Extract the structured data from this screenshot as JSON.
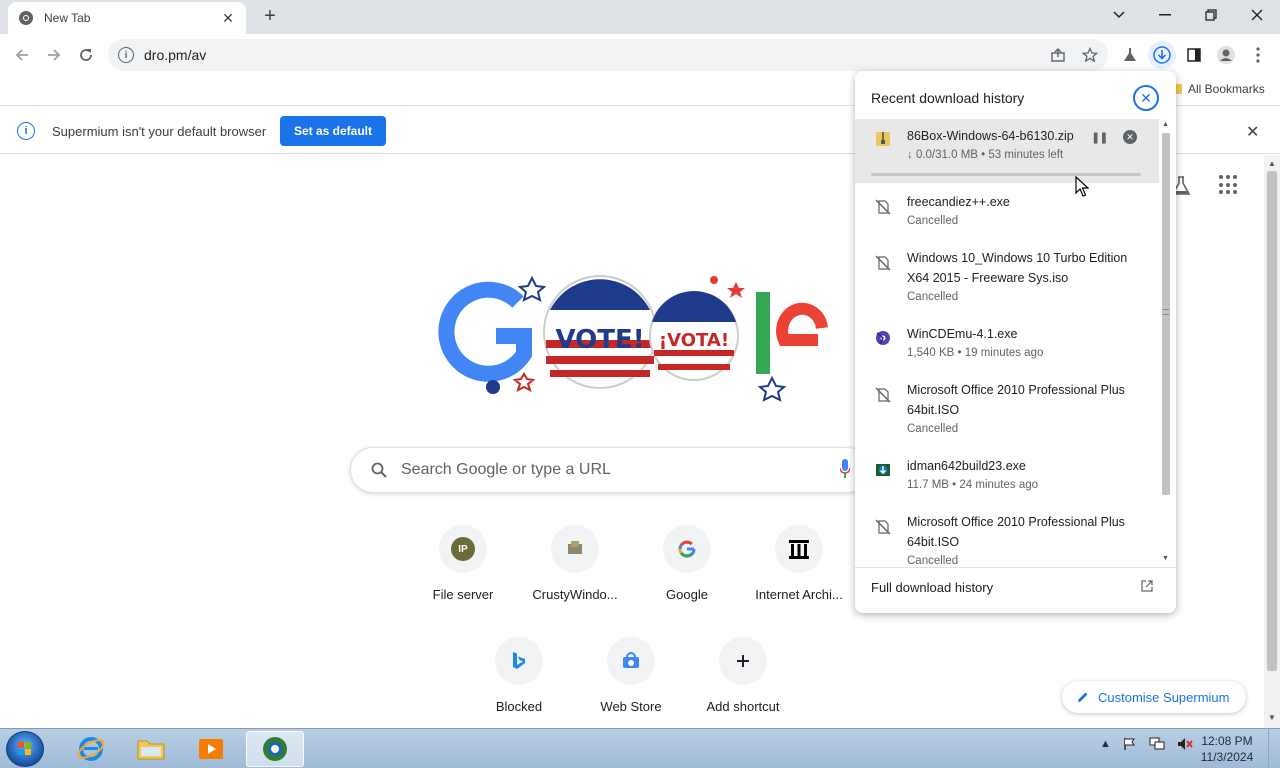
{
  "tab": {
    "title": "New Tab",
    "close_icon": "close-icon"
  },
  "toolbar": {
    "url": "dro.pm/av"
  },
  "bookmarks": {
    "all_label": "All Bookmarks"
  },
  "infobar": {
    "message": "Supermium isn't your default browser",
    "button": "Set as default"
  },
  "search": {
    "placeholder": "Search Google or type a URL"
  },
  "shortcuts": [
    {
      "label": "File server",
      "icon": "ip-icon",
      "icon_text": "IP"
    },
    {
      "label": "CrustyWindo...",
      "icon": "crustywindows-icon"
    },
    {
      "label": "Google",
      "icon": "google-g-icon"
    },
    {
      "label": "Internet Archi...",
      "icon": "archive-icon"
    },
    {
      "label": "Blocked",
      "icon": "bing-icon"
    },
    {
      "label": "Web Store",
      "icon": "webstore-icon"
    },
    {
      "label": "Add shortcut",
      "icon": "plus-icon"
    }
  ],
  "customise": {
    "label": "Customise Supermium"
  },
  "downloads": {
    "title": "Recent download history",
    "items": [
      {
        "name": "86Box-Windows-64-b6130.zip",
        "status": "↓ 0.0/31.0 MB • 53 minutes left",
        "icon": "zip-icon",
        "progress": 0
      },
      {
        "name": "freecandiez++.exe",
        "status": "Cancelled",
        "icon": "cancelled-file-icon"
      },
      {
        "name": "Windows 10_Windows 10 Turbo Edition X64 2015 - Freeware Sys.iso",
        "status": "Cancelled",
        "icon": "cancelled-file-icon"
      },
      {
        "name": "WinCDEmu-4.1.exe",
        "status": "1,540 KB • 19 minutes ago",
        "icon": "wincdemu-icon"
      },
      {
        "name": "Microsoft Office 2010 Professional Plus 64bit.ISO",
        "status": "Cancelled",
        "icon": "cancelled-file-icon"
      },
      {
        "name": "idman642build23.exe",
        "status": "11.7 MB • 24 minutes ago",
        "icon": "idm-icon"
      },
      {
        "name": "Microsoft Office 2010 Professional Plus 64bit.ISO",
        "status": "Cancelled",
        "icon": "cancelled-file-icon"
      }
    ],
    "footer": "Full download history"
  },
  "taskbar": {
    "time": "12:08 PM",
    "date": "11/3/2024"
  },
  "colors": {
    "accent": "#1a73e8",
    "tabstrip": "#dee1e6"
  }
}
